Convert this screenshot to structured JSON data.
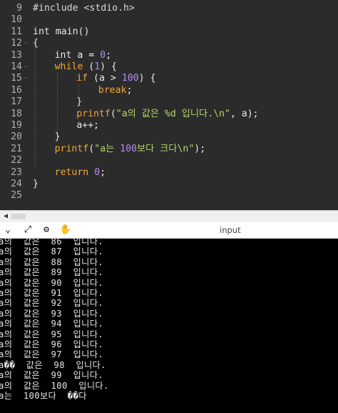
{
  "editor": {
    "lines": [
      {
        "num": "9",
        "indent": 0,
        "fold": "",
        "tokens": [
          {
            "t": "#include <stdio.h>",
            "c": "pp"
          }
        ]
      },
      {
        "num": "10",
        "indent": 0,
        "fold": "",
        "tokens": []
      },
      {
        "num": "11",
        "indent": 0,
        "fold": "",
        "tokens": [
          {
            "t": "int",
            "c": "fn"
          },
          {
            "t": " main()",
            "c": "fn"
          }
        ]
      },
      {
        "num": "12",
        "indent": 0,
        "fold": "-",
        "tokens": [
          {
            "t": "{",
            "c": "fn"
          }
        ]
      },
      {
        "num": "13",
        "indent": 1,
        "fold": "",
        "tokens": [
          {
            "t": "int",
            "c": "fn"
          },
          {
            "t": " a ",
            "c": "fn"
          },
          {
            "t": "=",
            "c": "op"
          },
          {
            "t": " ",
            "c": "fn"
          },
          {
            "t": "0",
            "c": "num"
          },
          {
            "t": ";",
            "c": "fn"
          }
        ]
      },
      {
        "num": "14",
        "indent": 1,
        "fold": "-",
        "tokens": [
          {
            "t": "while",
            "c": "kw"
          },
          {
            "t": " (",
            "c": "fn"
          },
          {
            "t": "1",
            "c": "num"
          },
          {
            "t": ") {",
            "c": "fn"
          }
        ]
      },
      {
        "num": "15",
        "indent": 2,
        "fold": "-",
        "tokens": [
          {
            "t": "if",
            "c": "kw"
          },
          {
            "t": " (a ",
            "c": "fn"
          },
          {
            "t": ">",
            "c": "op"
          },
          {
            "t": " ",
            "c": "fn"
          },
          {
            "t": "100",
            "c": "num"
          },
          {
            "t": ") {",
            "c": "fn"
          }
        ]
      },
      {
        "num": "16",
        "indent": 3,
        "fold": "",
        "tokens": [
          {
            "t": "break",
            "c": "kw"
          },
          {
            "t": ";",
            "c": "fn"
          }
        ]
      },
      {
        "num": "17",
        "indent": 2,
        "fold": "",
        "tokens": [
          {
            "t": "}",
            "c": "fn"
          }
        ]
      },
      {
        "num": "18",
        "indent": 2,
        "fold": "",
        "tokens": [
          {
            "t": "printf",
            "c": "kw"
          },
          {
            "t": "(",
            "c": "fn"
          },
          {
            "t": "\"a의 값은 %d 입니다.\\n\"",
            "c": "str"
          },
          {
            "t": ", a);",
            "c": "fn"
          }
        ]
      },
      {
        "num": "19",
        "indent": 2,
        "fold": "",
        "tokens": [
          {
            "t": "a++;",
            "c": "fn"
          }
        ]
      },
      {
        "num": "20",
        "indent": 1,
        "fold": "",
        "tokens": [
          {
            "t": "}",
            "c": "fn"
          }
        ]
      },
      {
        "num": "21",
        "indent": 1,
        "fold": "",
        "tokens": [
          {
            "t": "printf",
            "c": "kw"
          },
          {
            "t": "(",
            "c": "fn"
          },
          {
            "t": "\"a는 ",
            "c": "str"
          },
          {
            "t": "100",
            "c": "num"
          },
          {
            "t": "보다 크다\\n\"",
            "c": "str"
          },
          {
            "t": ");",
            "c": "fn"
          }
        ]
      },
      {
        "num": "22",
        "indent": 0,
        "fold": "",
        "tokens": []
      },
      {
        "num": "23",
        "indent": 1,
        "fold": "",
        "tokens": [
          {
            "t": "return",
            "c": "kw"
          },
          {
            "t": " ",
            "c": "fn"
          },
          {
            "t": "0",
            "c": "num"
          },
          {
            "t": ";",
            "c": "fn"
          }
        ]
      },
      {
        "num": "24",
        "indent": 0,
        "fold": "",
        "tokens": [
          {
            "t": "}",
            "c": "fn"
          }
        ]
      },
      {
        "num": "25",
        "indent": 0,
        "fold": "",
        "tokens": []
      }
    ]
  },
  "toolbar": {
    "icons": [
      {
        "name": "collapse-chevron-icon",
        "glyph": "⌄"
      },
      {
        "name": "expand-arrows-icon",
        "glyph": "⤢"
      },
      {
        "name": "settings-gear-icon",
        "glyph": "⚙"
      },
      {
        "name": "stdin-hand-icon",
        "glyph": "✋"
      }
    ],
    "title": "input"
  },
  "console": {
    "lines": [
      "a의  값은  86  입니다.",
      "a의  값은  87  입니다.",
      "a의  값은  88  입니다.",
      "a의  값은  89  입니다.",
      "a의  값은  90  입니다.",
      "a의  값은  91  입니다.",
      "a의  값은  92  입니다.",
      "a의  값은  93  입니다.",
      "a의  값은  94  입니다.",
      "a의  값은  95  입니다.",
      "a의  값은  96  입니다.",
      "a의  값은  97  입니다.",
      "a��  값은  98  입니다.",
      "a의  값은  99  입니다.",
      "a의  값은  100  입니다.",
      "a는  100보다  ��다"
    ]
  },
  "colors": {
    "editor_bg": "#2b2b2b",
    "keyword": "#f0a63a",
    "number": "#b58cf0",
    "string": "#b6d36a",
    "console_bg": "#000000",
    "console_text": "#e6e6e6"
  }
}
